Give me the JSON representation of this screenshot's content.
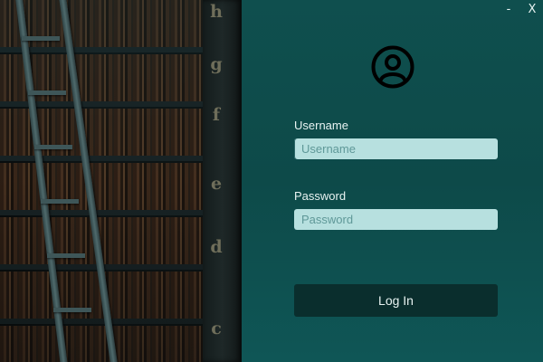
{
  "window": {
    "minimize_label": "-",
    "close_label": "X"
  },
  "library": {
    "shelf_letters": [
      "h",
      "g",
      "f",
      "e",
      "d",
      "c"
    ]
  },
  "login": {
    "avatar_icon": "user-circle-icon",
    "username": {
      "label": "Username",
      "placeholder": "Username",
      "value": ""
    },
    "password": {
      "label": "Password",
      "placeholder": "Password",
      "value": ""
    },
    "login_button_label": "Log In"
  },
  "colors": {
    "panel_bg": "#0d4a49",
    "input_bg": "#b7e0df",
    "button_bg": "#0a2e2d",
    "text_light": "#e8f3f2"
  }
}
